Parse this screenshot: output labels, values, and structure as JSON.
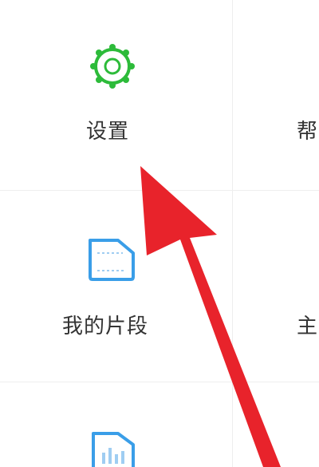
{
  "grid": {
    "row1": {
      "left": {
        "label": "设置",
        "icon": "gear-icon",
        "icon_color": "#2dbb3a"
      },
      "right": {
        "label": "帮",
        "icon": ""
      }
    },
    "row2": {
      "left": {
        "label": "我的片段",
        "icon": "snippet-card-icon",
        "icon_color": "#3a9ee8"
      },
      "right": {
        "label": "主",
        "icon": ""
      }
    },
    "row3": {
      "left": {
        "label": "",
        "icon": "document-chart-icon",
        "icon_color": "#3a9ee8"
      }
    }
  },
  "annotation": {
    "arrow_color": "#e8232b",
    "arrow_icon": "pointer-arrow"
  }
}
